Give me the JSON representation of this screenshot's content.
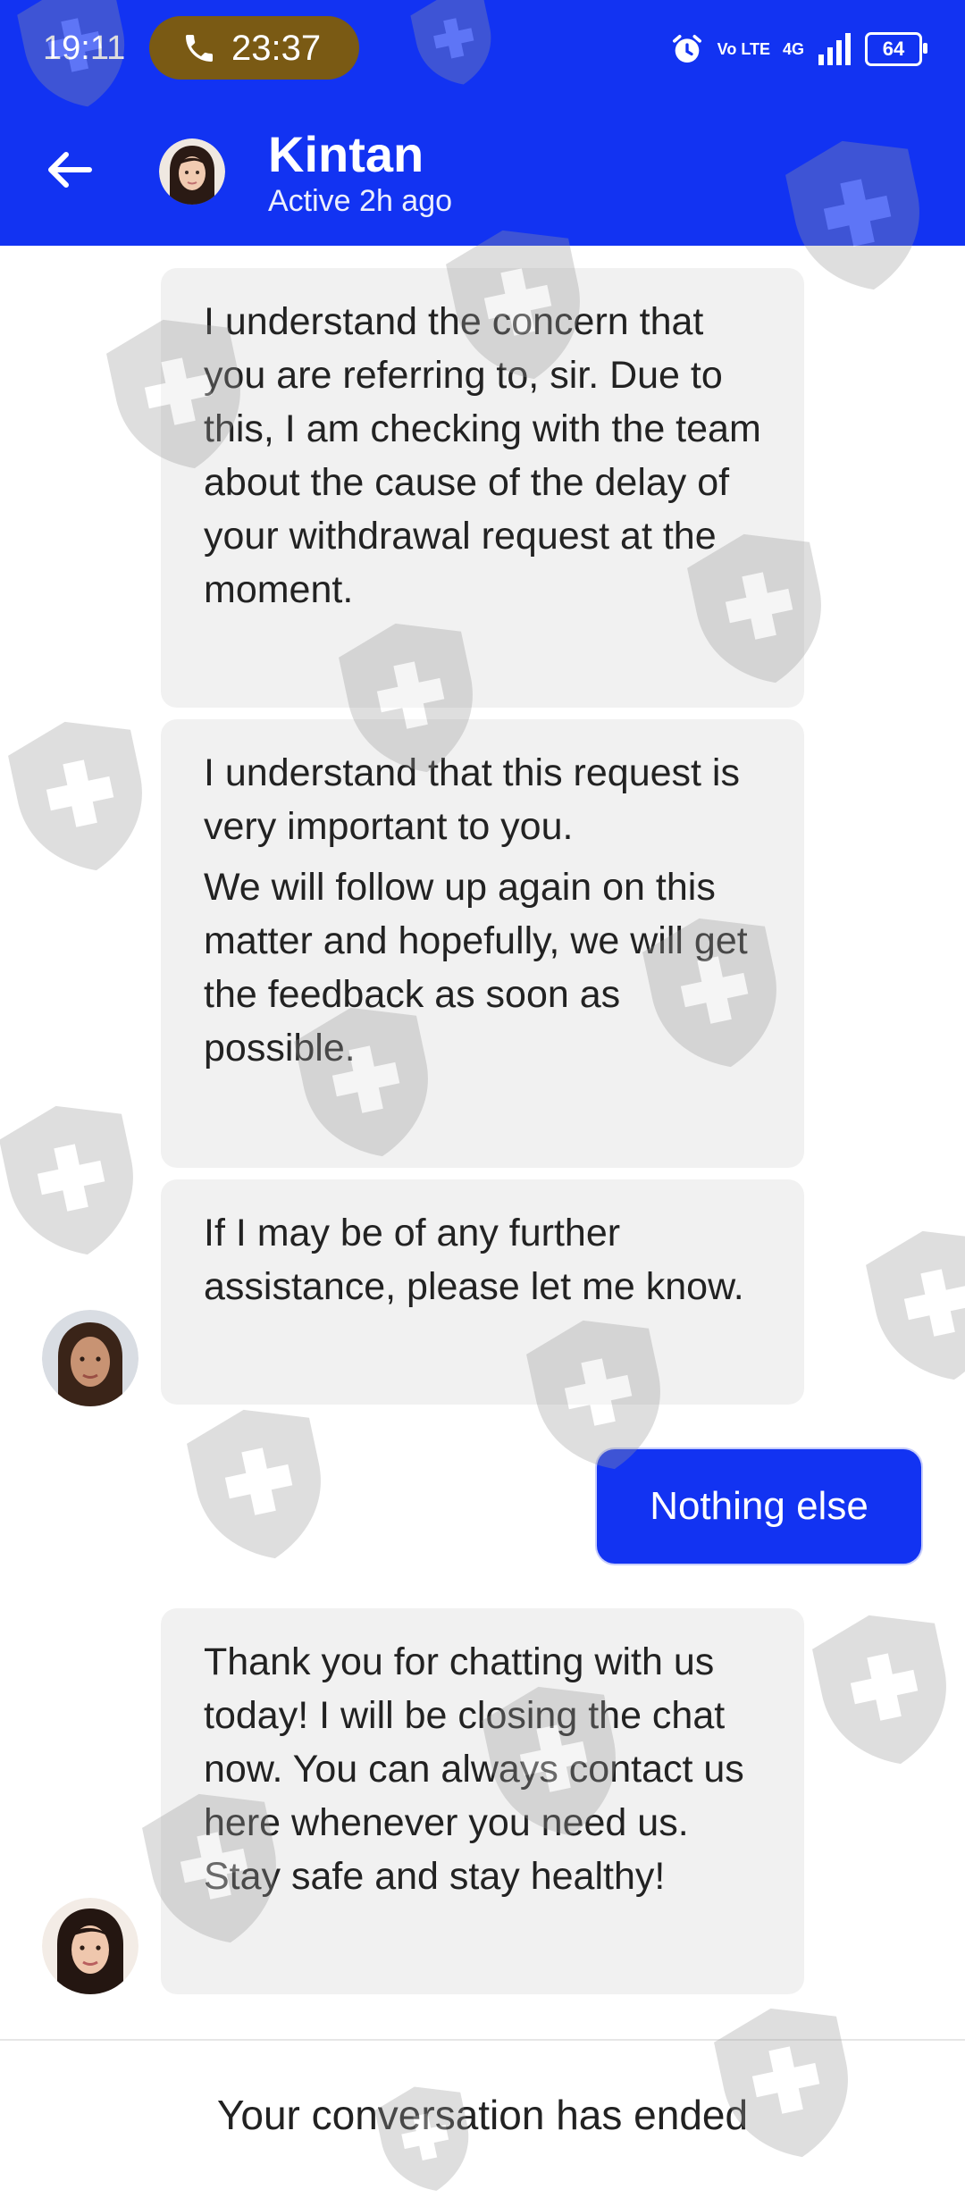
{
  "status_bar": {
    "time": "19:11",
    "call_timer": "23:37",
    "volte": "Vo LTE",
    "network": "4G",
    "battery": "64"
  },
  "header": {
    "back_icon": "arrow-left-icon",
    "name": "Kintan",
    "status": "Active 2h ago"
  },
  "messages": [
    {
      "from": "agent",
      "paragraphs": [
        "I understand the concern that you are referring to, sir. Due to this, I am checking with the team about the cause of the delay of your withdrawal request at the moment."
      ]
    },
    {
      "from": "agent",
      "paragraphs": [
        "I understand that this request is very important to you.",
        "We will follow up again on this matter and hopefully, we will get the feedback as soon as possible."
      ]
    },
    {
      "from": "agent",
      "paragraphs": [
        "If I may be of any further assistance, please let me know."
      ]
    },
    {
      "from": "user",
      "text": "Nothing else"
    },
    {
      "from": "agent",
      "paragraphs": [
        "Thank you for chatting with us today! I will be closing the chat now. You can always contact us here whenever you need us. Stay safe and stay healthy!"
      ]
    }
  ],
  "footer": {
    "ended_text": "Your conversation has ended"
  },
  "colors": {
    "brand_blue": "#1233f2",
    "call_pill": "#7a5a14",
    "bubble_bg": "#f1f1f1"
  }
}
